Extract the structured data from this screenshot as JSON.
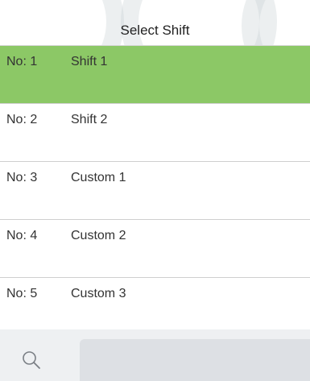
{
  "header": {
    "title": "Select Shift"
  },
  "shifts": [
    {
      "no": "No: 1",
      "name": "Shift 1",
      "selected": true
    },
    {
      "no": "No: 2",
      "name": "Shift 2",
      "selected": false
    },
    {
      "no": "No: 3",
      "name": "Custom 1",
      "selected": false
    },
    {
      "no": "No: 4",
      "name": "Custom 2",
      "selected": false
    },
    {
      "no": "No: 5",
      "name": "Custom 3",
      "selected": false
    }
  ],
  "footer": {
    "search_icon": "search-icon",
    "search_value": ""
  },
  "colors": {
    "selected_row": "#8cc866",
    "footer_bg": "#eef0f2",
    "search_field_bg": "#dde0e4"
  }
}
